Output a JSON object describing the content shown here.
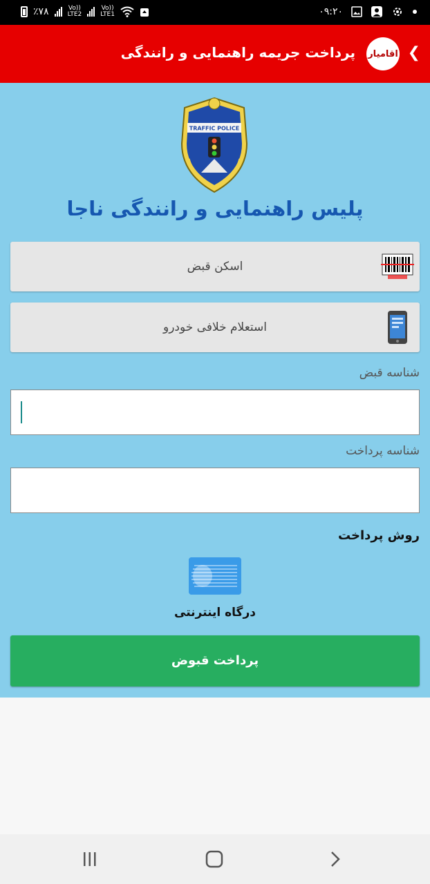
{
  "status_bar": {
    "battery": "٪۷۸",
    "sim2": "LTE2",
    "sim1": "LTE1",
    "volte": "Vo))",
    "time": "۰۹:۲۰"
  },
  "header": {
    "title": "پرداخت جریمه راهنمایی و رانندگی",
    "back_glyph": "❮",
    "logo_text": "اقامیار"
  },
  "badge": {
    "text": "TRAFFIC POLICE"
  },
  "org_title": "پلیس راهنمایی و رانندگی ناجا",
  "buttons": {
    "scan_bill": "اسکن قبض",
    "vehicle_inquiry": "استعلام خلافی خودرو"
  },
  "fields": {
    "bill_id_label": "شناسه قبض",
    "bill_id_value": "",
    "payment_id_label": "شناسه پرداخت",
    "payment_id_value": ""
  },
  "payment_method": {
    "label": "روش پرداخت",
    "gateway_label": "درگاه اینترنتی"
  },
  "pay_button": "پرداخت قبوض",
  "colors": {
    "header": "#e60000",
    "content_bg": "#87ceeb",
    "title": "#1657b0",
    "pay_button": "#27ae60"
  }
}
